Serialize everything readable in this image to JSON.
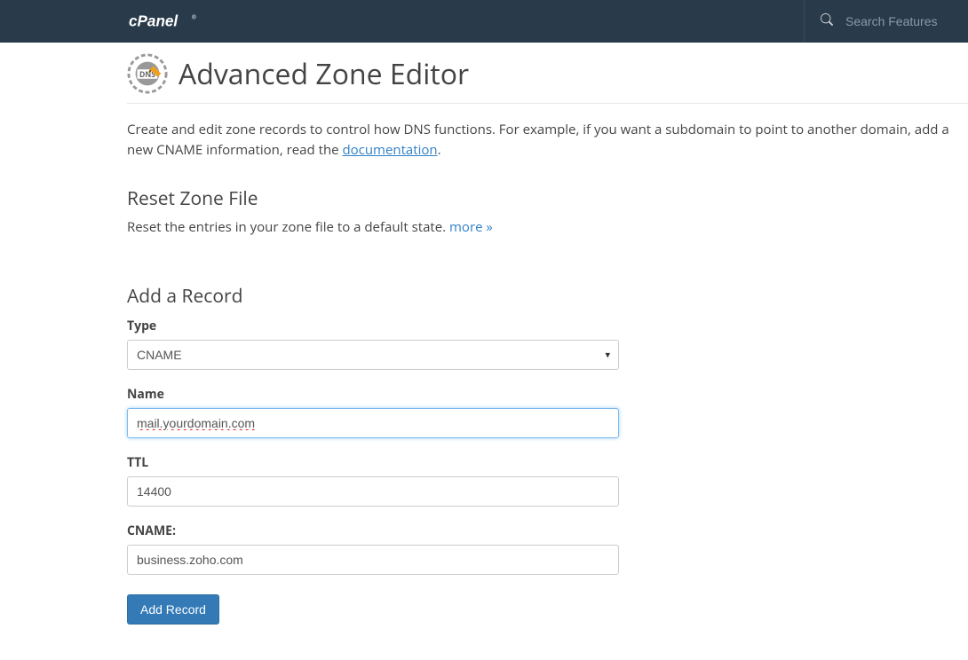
{
  "header": {
    "logo_text": "cPanel",
    "search_placeholder": "Search Features"
  },
  "page": {
    "title": "Advanced Zone Editor",
    "intro_prefix": "Create and edit zone records to control how DNS functions. For example, if you want a subdomain to point to another domain, add a new CNAME information, read the ",
    "doc_link_text": "documentation",
    "intro_suffix": "."
  },
  "reset_section": {
    "heading": "Reset Zone File",
    "desc_prefix": "Reset the entries in your zone file to a default state. ",
    "more_link": "more »"
  },
  "form": {
    "heading": "Add a Record",
    "type_label": "Type",
    "type_value": "CNAME",
    "name_label": "Name",
    "name_value": "mail.yourdomain.com",
    "ttl_label": "TTL",
    "ttl_value": "14400",
    "cname_label": "CNAME:",
    "cname_value": "business.zoho.com",
    "submit_label": "Add Record"
  }
}
